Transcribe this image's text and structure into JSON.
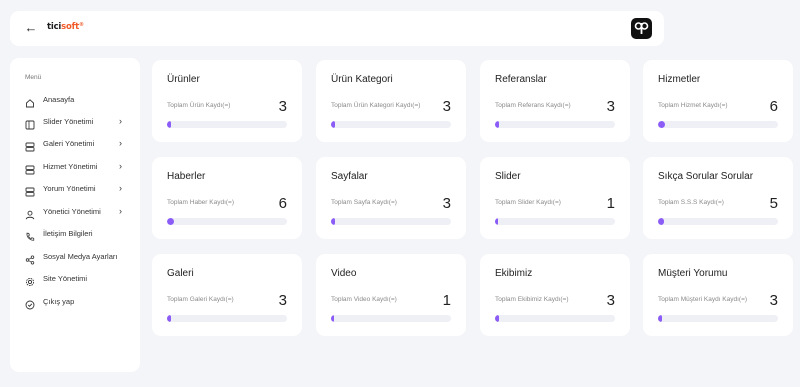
{
  "header": {
    "logo_part1": "tici",
    "logo_part2": "soft",
    "logo_tail": "®"
  },
  "sidebar": {
    "title": "Menü",
    "items": [
      {
        "label": "Anasayfa",
        "icon": "home-icon",
        "chevron": false
      },
      {
        "label": "Slider Yönetimi",
        "icon": "slider-icon",
        "chevron": true
      },
      {
        "label": "Galeri Yönetimi",
        "icon": "gallery-icon",
        "chevron": true
      },
      {
        "label": "Hizmet Yönetimi",
        "icon": "service-icon",
        "chevron": true
      },
      {
        "label": "Yorum Yönetimi",
        "icon": "comment-icon",
        "chevron": true
      },
      {
        "label": "Yönetici Yönetimi",
        "icon": "user-icon",
        "chevron": true
      },
      {
        "label": "İletişim Bilgileri",
        "icon": "phone-icon",
        "chevron": false
      },
      {
        "label": "Sosyal Medya Ayarları",
        "icon": "share-icon",
        "chevron": false
      },
      {
        "label": "Site Yönetimi",
        "icon": "gear-icon",
        "chevron": false
      },
      {
        "label": "Çıkış yap",
        "icon": "logout-icon",
        "chevron": false
      }
    ]
  },
  "cards": [
    {
      "title": "Ürünler",
      "subtitle": "Toplam Ürün Kaydı(=)",
      "count": "3",
      "progress": 0.03
    },
    {
      "title": "Ürün Kategori",
      "subtitle": "Toplam Ürün Kategori Kaydı(=)",
      "count": "3",
      "progress": 0.03
    },
    {
      "title": "Referanslar",
      "subtitle": "Toplam Referans Kaydı(=)",
      "count": "3",
      "progress": 0.03
    },
    {
      "title": "Hizmetler",
      "subtitle": "Toplam Hizmet Kaydı(=)",
      "count": "6",
      "progress": 0.06
    },
    {
      "title": "Haberler",
      "subtitle": "Toplam Haber Kaydı(=)",
      "count": "6",
      "progress": 0.06
    },
    {
      "title": "Sayfalar",
      "subtitle": "Toplam Sayfa Kaydı(=)",
      "count": "3",
      "progress": 0.03
    },
    {
      "title": "Slider",
      "subtitle": "Toplam Slider Kaydı(=)",
      "count": "1",
      "progress": 0.01
    },
    {
      "title": "Sıkça Sorular Sorular",
      "subtitle": "Toplam S.S.S Kaydı(=)",
      "count": "5",
      "progress": 0.05
    },
    {
      "title": "Galeri",
      "subtitle": "Toplam Galeri Kaydı(=)",
      "count": "3",
      "progress": 0.03
    },
    {
      "title": "Video",
      "subtitle": "Toplam Video Kaydı(=)",
      "count": "1",
      "progress": 0.01
    },
    {
      "title": "Ekibimiz",
      "subtitle": "Toplam Ekibimiz Kaydı(=)",
      "count": "3",
      "progress": 0.03
    },
    {
      "title": "Müşteri Yorumu",
      "subtitle": "Toplam Müşteri Kaydı Kaydı(=)",
      "count": "3",
      "progress": 0.03
    }
  ],
  "colors": {
    "accent": "#8b5cf6",
    "logo_accent": "#f05a28"
  }
}
